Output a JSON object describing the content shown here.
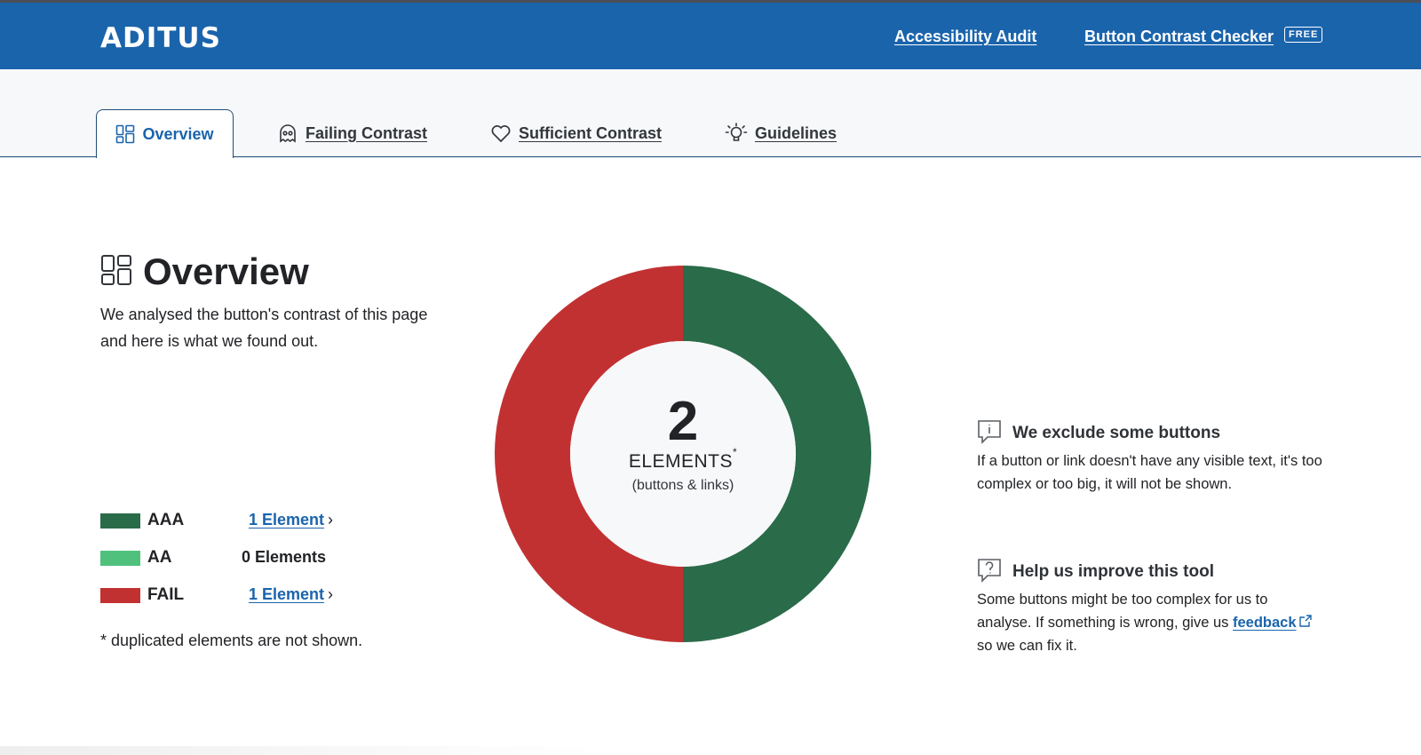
{
  "header": {
    "logo": "ADITUS",
    "nav": {
      "audit": "Accessibility Audit",
      "checker": "Button Contrast Checker",
      "free_badge": "FREE"
    },
    "color": "#1a64ac"
  },
  "tabs": [
    {
      "label": "Overview",
      "icon": "dashboard-icon",
      "active": true
    },
    {
      "label": "Failing Contrast",
      "icon": "ghost-icon",
      "active": false
    },
    {
      "label": "Sufficient Contrast",
      "icon": "heart-icon",
      "active": false
    },
    {
      "label": "Guidelines",
      "icon": "lightbulb-icon",
      "active": false
    }
  ],
  "overview": {
    "title": "Overview",
    "description": "We analysed the button's contrast of this page and here is what we found out.",
    "legend": [
      {
        "name": "AAA",
        "count_text": "1 Element",
        "chevron": "›",
        "color": "#2a6b4a",
        "is_link": true
      },
      {
        "name": "AA",
        "count_text": "0 Elements",
        "color": "#4fc17d",
        "is_link": false
      },
      {
        "name": "FAIL",
        "count_text": "1 Element",
        "chevron": "›",
        "color": "#c23132",
        "is_link": true
      }
    ],
    "footnote": "* duplicated elements are not shown."
  },
  "chart_data": {
    "type": "pie",
    "categories": [
      "AAA",
      "AA",
      "FAIL"
    ],
    "values": [
      1,
      0,
      1
    ],
    "colors": [
      "#2a6b4a",
      "#4fc17d",
      "#c23132"
    ],
    "center": {
      "total": "2",
      "label": "ELEMENTS",
      "marker": "*",
      "sublabel": "(buttons & links)"
    }
  },
  "info": [
    {
      "icon": "info-bubble-icon",
      "title": "We exclude some buttons",
      "body": "If a button or link doesn't have any visible text, it's too complex or too big, it will not be shown."
    },
    {
      "icon": "question-bubble-icon",
      "title": "Help us improve this tool",
      "body_before": "Some buttons might be too complex for us to analyse. If something is wrong, give us ",
      "link": "feedback",
      "body_after": " so we can fix it."
    }
  ]
}
